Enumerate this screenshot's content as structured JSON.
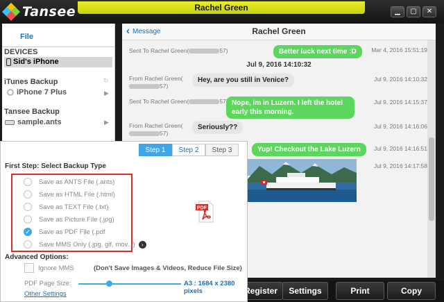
{
  "app": {
    "logo_text": "Tansee",
    "window_title": "Rachel Green"
  },
  "window_controls": {
    "minimize": "▁",
    "maximize": "▢",
    "close": "✕"
  },
  "sidebar": {
    "file_tab": "File",
    "devices_label": "DEVICES",
    "selected_device": "Sid's iPhone",
    "itunes_label": "iTunes Backup",
    "itunes_item": "iPhone 7 Plus",
    "tansee_label": "Tansee Backup",
    "tansee_item": "sample.ants"
  },
  "chat": {
    "back_label": "Message",
    "title": "Rachel Green",
    "messages": [
      {
        "meta": "Sent To Rachel Green(",
        "meta_tail": "57)",
        "text": "Better luck next time :D",
        "time": "Mar 4, 2016 15:51:19"
      },
      {
        "date_separator": "Jul 9, 2016 14:10:32"
      },
      {
        "meta": "From Rachel Green(",
        "meta_tail": "57)",
        "text": "Hey, are you still in Venice?",
        "time": "Jul 9, 2016 14:10:32"
      },
      {
        "meta": "Sent To Rachel Green(",
        "meta_tail": "57)",
        "text": "Nope, im in Luzern. I left the hotel early this morning.",
        "time": "Jul 9, 2016 14:15:37"
      },
      {
        "meta": "From Rachel Green(",
        "meta_tail": "57)",
        "text": "Seriously??",
        "time": "Jul 9, 2016 14:16:06"
      },
      {
        "text": "Yup! Checkout the Lake Luzern",
        "time": "Jul 9, 2016 14:16:51"
      },
      {
        "time": "Jul 9, 2016 14:17:58"
      }
    ]
  },
  "toolbar": {
    "register": "Register",
    "settings": "Settings",
    "print": "Print",
    "copy": "Copy"
  },
  "dialog": {
    "steps": [
      "Step 1",
      "Step 2",
      "Step 3"
    ],
    "active_step": 0,
    "step_title": "First Step: Select Backup Type",
    "options": [
      {
        "label": "Save as ANTS File (.ants)",
        "checked": false
      },
      {
        "label": "Save as HTML File (.html)",
        "checked": false
      },
      {
        "label": "Save as TEXT File (.txt)",
        "checked": false
      },
      {
        "label": "Save as Picture File (.jpg)",
        "checked": false
      },
      {
        "label": "Save as PDF File (.pdf",
        "checked": true
      },
      {
        "label": "Save MMS Only (.jpg, gif, mov...)",
        "checked": false
      }
    ],
    "pdf_icon_label": "PDF",
    "advanced_title": "Advanced Options:",
    "ignore_mms": "Ignore MMS",
    "ignore_note": "(Don't Save Images & Videos, Reduce File Size)",
    "pdf_page_size_label": "PDF Page Size:",
    "page_size_value": "A3 : 1684 x 2380 pixels",
    "other_settings": "Other Settings"
  },
  "colors": {
    "accent": "#3fa6ea",
    "title_bar": "#dfe61a",
    "sent_bubble": "#5cd65c",
    "highlight_box": "#d32f2f"
  }
}
